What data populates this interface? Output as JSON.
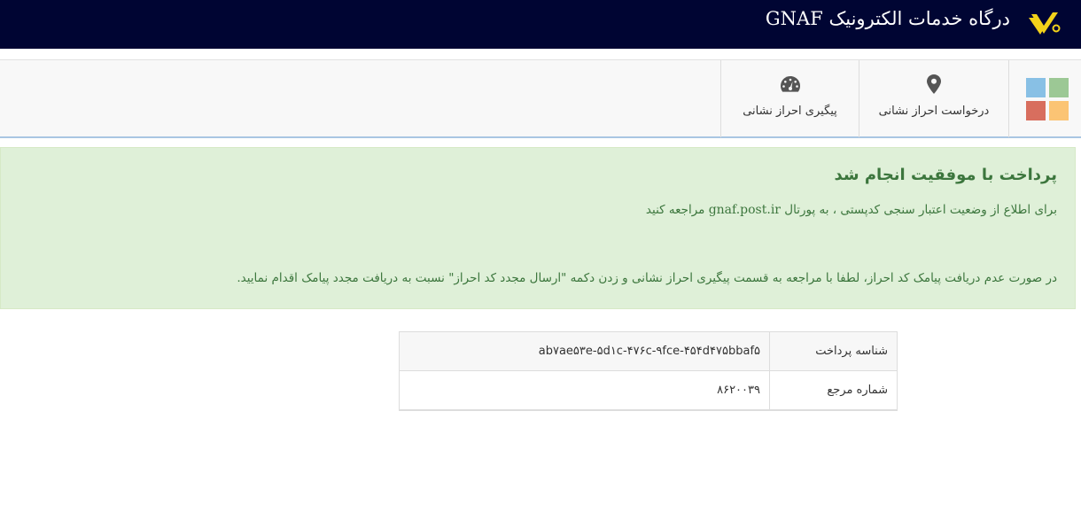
{
  "header": {
    "title": "درگاه خدمات الکترونیک GNAF",
    "logo_icon": "post-logo-icon",
    "background": "#000533"
  },
  "nav": {
    "items": [
      {
        "label": "درخواست احراز نشانی",
        "icon": "map-marker-icon"
      },
      {
        "label": "پیگیری احراز نشانی",
        "icon": "dashboard-gauge-icon"
      }
    ],
    "apps_icon": "apps-grid-icon"
  },
  "alert": {
    "heading": "پرداخت با موفقیت انجام شد",
    "line1_before": "برای اطلاع از وضعیت اعتبار سنجی کدپستی ، به پورتال",
    "portal": "gnaf.post.ir",
    "line1_after": "مراجعه کنید",
    "line2": "در صورت عدم دریافت پیامک کد احراز، لطفا با مراجعه به قسمت پیگیری احراز نشانی و زدن دکمه \"ارسال مجدد کد احراز\" نسبت به دریافت مجدد پیامک اقدام نمایید.",
    "background": "#dff0d8",
    "text_color": "#3c763d"
  },
  "details": {
    "rows": [
      {
        "label": "شناسه پرداخت",
        "value": "ab۷ae۵۳e-۵d۱c-۴۷۶c-۹fce-۴۵۴d۴۷۵bbaf۵"
      },
      {
        "label": "شماره مرجع",
        "value": "۸۶۲۰۰۳۹"
      }
    ]
  }
}
